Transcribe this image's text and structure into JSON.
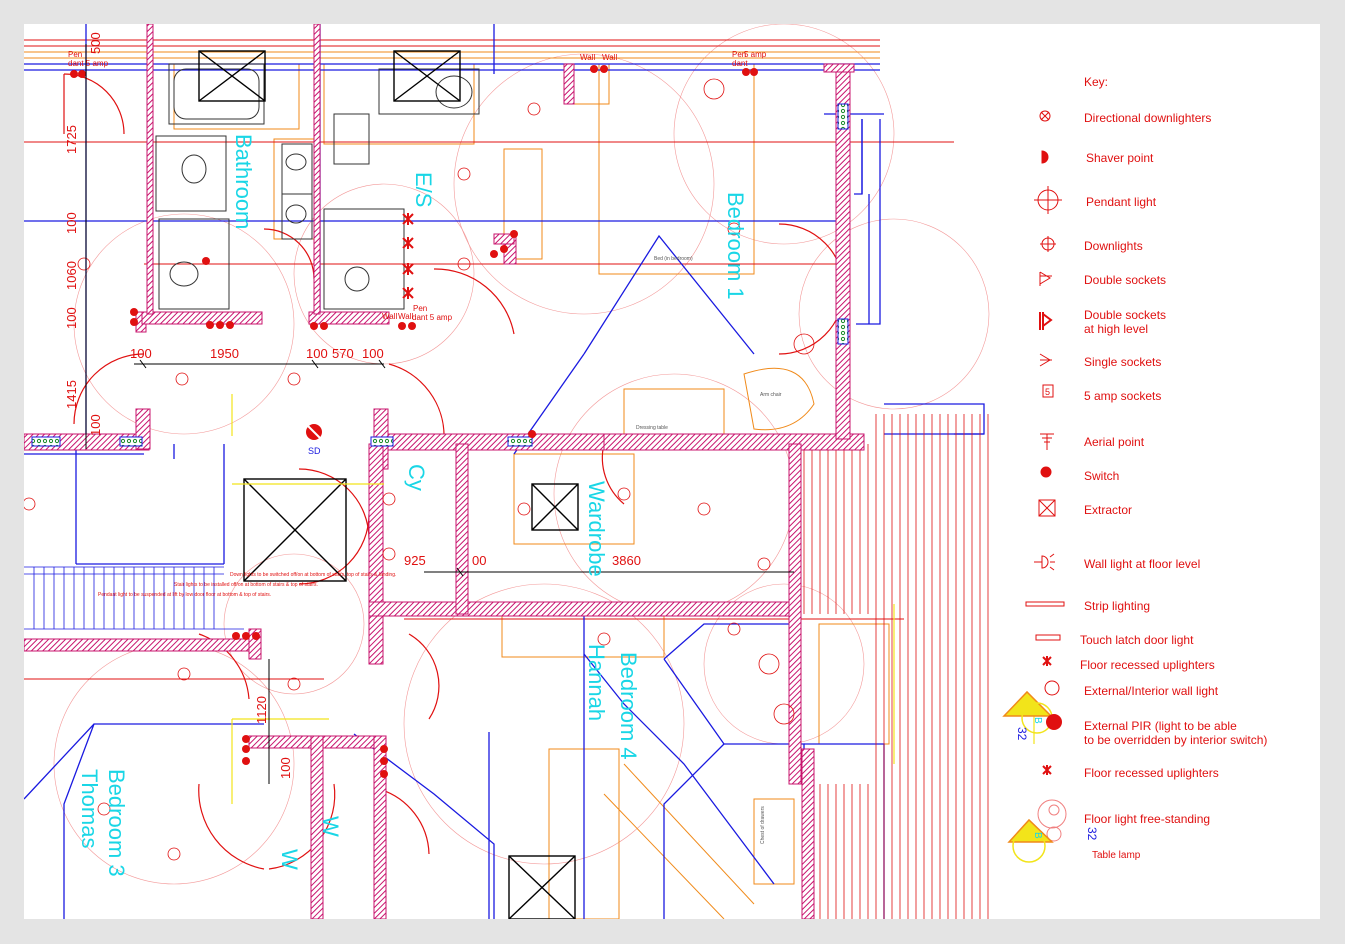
{
  "key": {
    "title": "Key:",
    "items": [
      {
        "label": "Directional downlighters",
        "icon": "directional-downlighter-icon"
      },
      {
        "label": "Shaver point",
        "icon": "shaver-point-icon"
      },
      {
        "label": "Pendant light",
        "icon": "pendant-light-icon"
      },
      {
        "label": "Downlights",
        "icon": "downlight-icon"
      },
      {
        "label": "Double sockets",
        "icon": "double-socket-icon"
      },
      {
        "label": "Double sockets\nat high level",
        "icon": "double-socket-high-icon"
      },
      {
        "label": "Single sockets",
        "icon": "single-socket-icon"
      },
      {
        "label": "5 amp sockets",
        "icon": "five-amp-socket-icon"
      },
      {
        "label": "Aerial point",
        "icon": "aerial-point-icon"
      },
      {
        "label": "Switch",
        "icon": "switch-icon"
      },
      {
        "label": "Extractor",
        "icon": "extractor-icon"
      },
      {
        "label": "Wall light at floor level",
        "icon": "wall-light-floor-icon"
      },
      {
        "label": "Strip lighting",
        "icon": "strip-lighting-icon"
      },
      {
        "label": "Touch latch door light",
        "icon": "touch-latch-light-icon"
      },
      {
        "label": "Floor recessed uplighters",
        "icon": "floor-uplighter-icon"
      },
      {
        "label": "External/Interior wall light",
        "icon": "wall-light-icon"
      },
      {
        "label": "External PIR (light to be able\nto be overridden by interior switch)",
        "icon": "pir-icon"
      },
      {
        "label": "Floor recessed uplighters",
        "icon": "floor-uplighter-icon"
      },
      {
        "label": "Floor light free-standing",
        "icon": "floor-light-icon"
      }
    ],
    "table_lamp": "Table lamp",
    "five_glyph": "5",
    "pir_code": "32",
    "pir_letter": "B"
  },
  "rooms": {
    "bathroom": "Bathroom",
    "en_suite": "E/S",
    "bedroom1": "Bedroom 1",
    "wardrobe": "Wardrobe",
    "cupboard": "Cy",
    "bedroom4": "Bedroom 4",
    "hannah": "Hannah",
    "bedroom3": "Bedroom 3",
    "thomas": "Thomas",
    "w1": "W",
    "w2": "W"
  },
  "dimensions": {
    "d500": "500",
    "d1725": "1725",
    "d100a": "100",
    "d1060": "1060",
    "d100b": "100",
    "d1415": "1415",
    "d100c": "100",
    "row": [
      "100",
      "1950",
      "100",
      "570",
      "100"
    ],
    "d925": "925",
    "d00": "00",
    "d3860": "3860",
    "d1120": "1120",
    "d100d": "100"
  },
  "labels": {
    "pendant_a": "Pen",
    "pendant_b": "dant 5 amp",
    "wall_light": "Wall",
    "wall_b": "Wall",
    "pen_top": "Pen",
    "amp_top": "5 amp",
    "dant_top": "dant",
    "wall_mid": "Wall",
    "wall_mid2": "Wall",
    "pen_mid": "Pen",
    "dant_mid": "dant 5 amp",
    "smoke": "SD",
    "stair_note1": "Pendant light to be suspended at lift by low door floor at bottom & top of stairs.",
    "stair_note2": "Stair lights to be installed off/on at bottom of stairs & top of stairs.",
    "stair_note3": "Down lights to be switched off/on at bottom of stairs, top of stairs & landing.",
    "dressing_table": "Dressing table",
    "arm_chair": "Arm chair",
    "chest_drawers": "Chest of drawers",
    "bed_dims": "Bed (in bedroom)"
  },
  "colors": {
    "red": "#e01010",
    "blue": "#1a1ae0",
    "cyan": "#19d6e6",
    "orange": "#f08a1a",
    "yellow": "#f2e41a",
    "wall_hatch": "#c8146e",
    "black": "#000000"
  }
}
